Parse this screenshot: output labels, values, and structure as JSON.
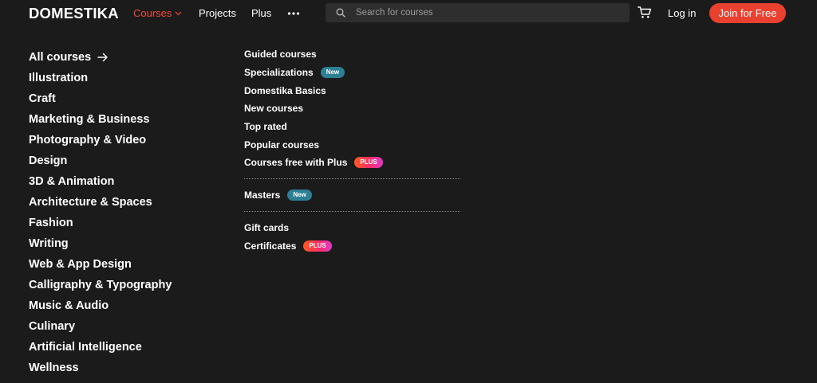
{
  "header": {
    "logo": "DOMESTIKA",
    "nav": {
      "courses": "Courses",
      "projects": "Projects",
      "plus": "Plus"
    },
    "search_placeholder": "Search for courses",
    "login": "Log in",
    "join": "Join for Free"
  },
  "categories": [
    "All courses",
    "Illustration",
    "Craft",
    "Marketing & Business",
    "Photography & Video",
    "Design",
    "3D & Animation",
    "Architecture & Spaces",
    "Fashion",
    "Writing",
    "Web & App Design",
    "Calligraphy & Typography",
    "Music & Audio",
    "Culinary",
    "Artificial Intelligence",
    "Wellness"
  ],
  "menu": {
    "guided": "Guided courses",
    "specializations": "Specializations",
    "basics": "Domestika Basics",
    "new_courses": "New courses",
    "top_rated": "Top rated",
    "popular": "Popular courses",
    "free_plus": "Courses free with Plus",
    "masters": "Masters",
    "gift_cards": "Gift cards",
    "certificates": "Certificates"
  },
  "badges": {
    "new": "New",
    "plus": "PLUS"
  },
  "colors": {
    "background": "#1b1b1b",
    "accent": "#e9402f",
    "active_nav": "#ef4a3b",
    "new_badge": "#2d7f93",
    "search_bg": "#2e2e2e"
  },
  "icons": {
    "courses_dropdown": "chevron-down-icon",
    "more": "more-dots-icon",
    "search": "search-icon",
    "cart": "cart-icon",
    "all_courses": "arrow-right-icon"
  }
}
